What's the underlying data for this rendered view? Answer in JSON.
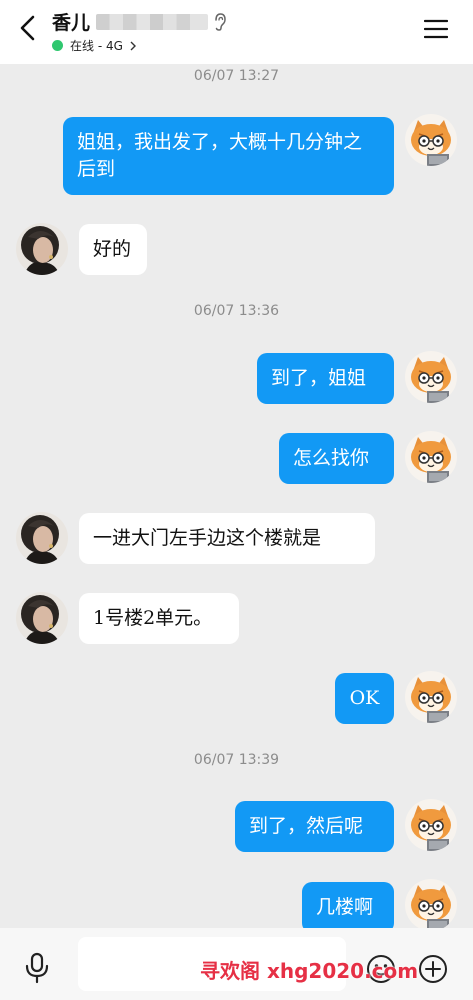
{
  "header": {
    "contact_name": "香儿",
    "status_text": "在线 - 4G"
  },
  "messages": [
    {
      "type": "time",
      "text": "06/07 13:27"
    },
    {
      "type": "out",
      "text": "姐姐，我出发了，大概十几分钟之后到"
    },
    {
      "type": "in",
      "text": "好的"
    },
    {
      "type": "time",
      "text": "06/07 13:36"
    },
    {
      "type": "out",
      "text": "到了，姐姐"
    },
    {
      "type": "out",
      "text": "怎么找你"
    },
    {
      "type": "in",
      "text": "一进大门左手边这个楼就是"
    },
    {
      "type": "in",
      "text": "1号楼2单元。"
    },
    {
      "type": "out",
      "text": "OK"
    },
    {
      "type": "time",
      "text": "06/07 13:39"
    },
    {
      "type": "out",
      "text": "到了，然后呢"
    },
    {
      "type": "out",
      "text": "几楼啊"
    }
  ],
  "input": {
    "placeholder": ""
  },
  "watermark": "寻欢阁 xhg2020.com",
  "colors": {
    "accent_bubble": "#1299f5",
    "online_dot": "#2fc76f",
    "background": "#ececec",
    "watermark": "#e63045"
  },
  "icons": [
    "back-arrow-icon",
    "ear-icon",
    "chevron-right-icon",
    "menu-icon",
    "cat-avatar-icon",
    "woman-avatar-icon",
    "microphone-icon",
    "emoji-icon",
    "plus-circle-icon"
  ]
}
